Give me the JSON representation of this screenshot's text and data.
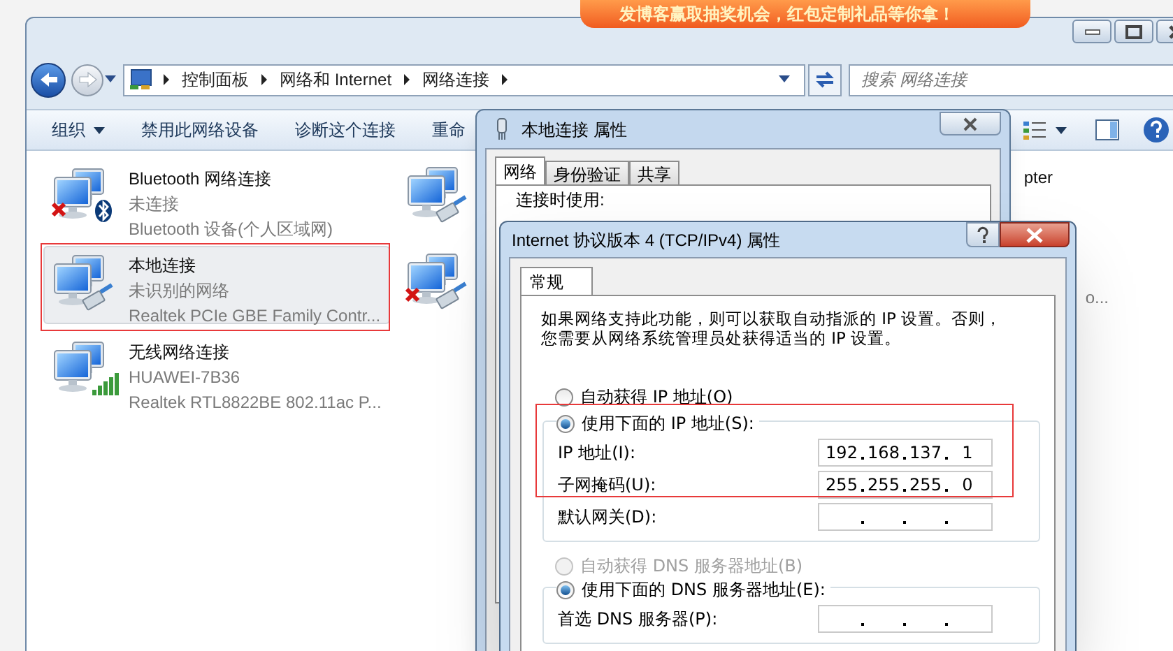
{
  "banner": {
    "text": "发博客赢取抽奖机会，红包定制礼品等你拿！"
  },
  "explorer": {
    "breadcrumb": [
      "控制面板",
      "网络和 Internet",
      "网络连接"
    ],
    "search": {
      "placeholder": "搜索 网络连接"
    },
    "toolbar": [
      {
        "label": "组织",
        "dropdown": true
      },
      {
        "label": "禁用此网络设备",
        "dropdown": false
      },
      {
        "label": "诊断这个连接",
        "dropdown": false
      },
      {
        "label": "重命",
        "dropdown": false
      }
    ],
    "connections": [
      {
        "name": "Bluetooth 网络连接",
        "status": "未连接",
        "device": "Bluetooth 设备(个人区域网)",
        "kind": "bluetooth",
        "disconnected": true,
        "selected": false
      },
      {
        "name": "本地连接",
        "status": "未识别的网络",
        "device": "Realtek PCIe GBE Family Contr...",
        "kind": "ethernet",
        "disconnected": false,
        "selected": true
      },
      {
        "name": "无线网络连接",
        "status": "HUAWEI-7B36",
        "device": "Realtek RTL8822BE 802.11ac P...",
        "kind": "wireless",
        "disconnected": false,
        "selected": false
      }
    ],
    "connections_column_2": [
      {
        "text": "pter",
        "kind": "ethernet",
        "disconnected": false
      },
      {
        "text": "o...",
        "kind": "ethernet",
        "disconnected": true
      }
    ]
  },
  "properties_dialog": {
    "title": "本地连接 属性",
    "tabs": [
      {
        "label": "网络",
        "selected": true
      },
      {
        "label": "身份验证",
        "selected": false
      },
      {
        "label": "共享",
        "selected": false
      }
    ],
    "connect_using_label": "连接时使用:"
  },
  "ipv4_dialog": {
    "title": "Internet 协议版本 4 (TCP/IPv4) 属性",
    "tabs": [
      {
        "label": "常规",
        "selected": true
      }
    ],
    "description": "如果网络支持此功能，则可以获取自动指派的 IP 设置。否则，您需要从网络系统管理员处获得适当的 IP 设置。",
    "ip_options": [
      {
        "label": "自动获得 IP 地址(O)",
        "selected": false,
        "disabled": false
      },
      {
        "label": "使用下面的 IP 地址(S):",
        "selected": true,
        "disabled": false
      }
    ],
    "ip_fields": [
      {
        "label": "IP 地址(I):",
        "octets": [
          "192",
          "168",
          "137",
          "1"
        ]
      },
      {
        "label": "子网掩码(U):",
        "octets": [
          "255",
          "255",
          "255",
          "0"
        ]
      },
      {
        "label": "默认网关(D):"
      }
    ],
    "dns_options": [
      {
        "label": "自动获得 DNS 服务器地址(B)",
        "selected": false,
        "disabled": true
      },
      {
        "label": "使用下面的 DNS 服务器地址(E):",
        "selected": true,
        "disabled": false
      }
    ],
    "dns_fields": [
      {
        "label": "首选 DNS 服务器(P):"
      }
    ]
  }
}
